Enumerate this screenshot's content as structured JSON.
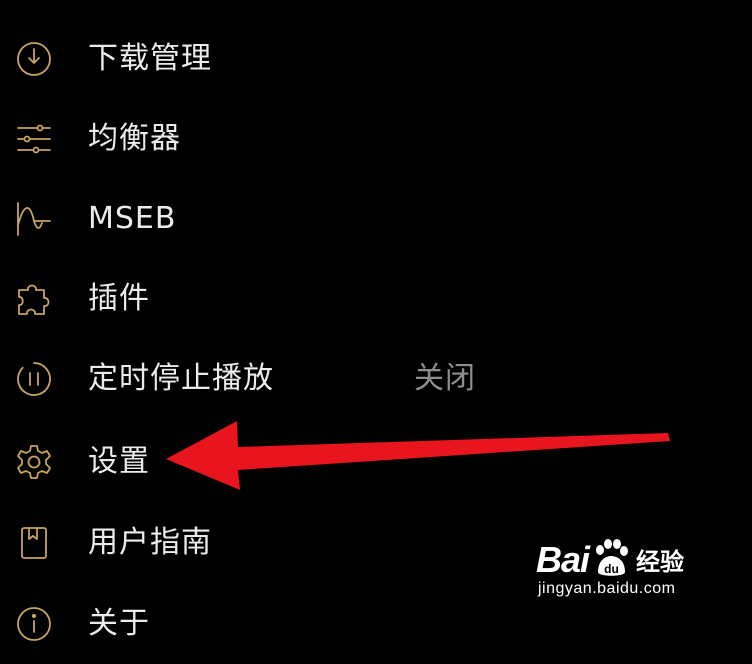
{
  "menu": {
    "items": [
      {
        "label": "下载管理",
        "icon": "download-circle-icon"
      },
      {
        "label": "均衡器",
        "icon": "equalizer-sliders-icon"
      },
      {
        "label": "MSEB",
        "icon": "mseb-wave-icon"
      },
      {
        "label": "插件",
        "icon": "puzzle-plugin-icon"
      },
      {
        "label": "定时停止播放",
        "value": "关闭",
        "icon": "timer-pause-icon"
      },
      {
        "label": "设置",
        "icon": "gear-icon"
      },
      {
        "label": "用户指南",
        "icon": "guide-book-icon"
      },
      {
        "label": "关于",
        "icon": "about-info-icon"
      }
    ]
  },
  "annotation": {
    "arrow_color": "#e8141e",
    "points_to": "设置"
  },
  "colors": {
    "icon_gold": "#c9a45c",
    "label": "#ebebeb",
    "value": "#8d8d8d",
    "background": "#000000"
  },
  "watermark": {
    "logo_text": "Bai",
    "paw_text": "du",
    "brand_cn": "经验",
    "url": "jingyan.baidu.com"
  }
}
